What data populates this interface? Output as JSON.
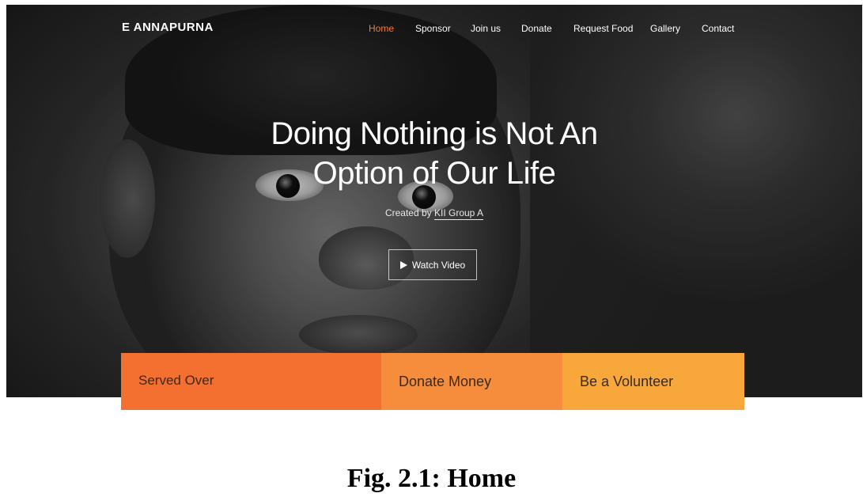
{
  "navbar": {
    "brand": "E ANNAPURNA",
    "items": [
      {
        "label": "Home",
        "active": true
      },
      {
        "label": "Sponsor",
        "active": false
      },
      {
        "label": "Join us",
        "active": false
      },
      {
        "label": "Donate",
        "active": false
      },
      {
        "label": "Request Food",
        "active": false
      },
      {
        "label": "Gallery",
        "active": false
      },
      {
        "label": "Contact",
        "active": false
      }
    ]
  },
  "hero": {
    "title_line1": "Doing Nothing is Not An",
    "title_line2": "Option of Our Life",
    "credit_prefix": "Created by",
    "credit_author": "KII Group A",
    "watch_button": "Watch Video"
  },
  "features": [
    {
      "label": "Served Over"
    },
    {
      "label": "Donate Money"
    },
    {
      "label": "Be a Volunteer"
    }
  ],
  "caption": "Fig. 2.1: Home",
  "colors": {
    "accent": "#f47a3a",
    "feature1": "#f47030",
    "feature2": "#f68d3c",
    "feature3": "#f8a83a"
  }
}
